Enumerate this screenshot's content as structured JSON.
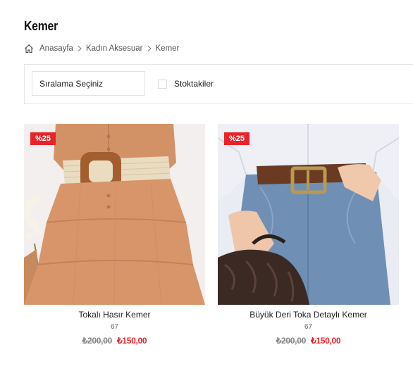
{
  "header": {
    "title": "Kemer"
  },
  "breadcrumb": {
    "home_icon": "home-icon",
    "items": [
      "Anasayfa",
      "Kadın Aksesuar",
      "Kemer"
    ]
  },
  "filters": {
    "sort_label": "Sıralama Seçiniz",
    "stock_label": "Stoktakiler",
    "stock_checked": false
  },
  "products": [
    {
      "discount": "%25",
      "name": "Tokalı Hasır Kemer",
      "stock": "67",
      "old_price": "₺200,00",
      "new_price": "₺150,00"
    },
    {
      "discount": "%25",
      "name": "Büyük Deri Toka Detaylı Kemer",
      "stock": "67",
      "old_price": "₺200,00",
      "new_price": "₺150,00"
    }
  ],
  "colors": {
    "accent": "#e8232a",
    "muted": "#888888"
  }
}
